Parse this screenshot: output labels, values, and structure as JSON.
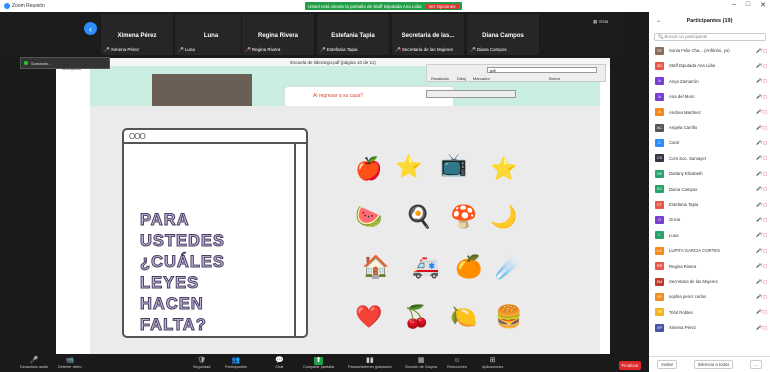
{
  "titlebar": {
    "app": "Zoom Reunión",
    "banner": "Usted está viendo la pantalla de Staff Diputada Ana Lidia",
    "stop_label": "Ver Opciones",
    "minimize": "–",
    "maximize": "□",
    "close": "✕"
  },
  "video_tiles": [
    {
      "name": "Ximena Pérez",
      "label": "Ximena Pérez"
    },
    {
      "name": "Luna",
      "label": "Luna"
    },
    {
      "name": "Regina Rivera",
      "label": "Regina Rivera"
    },
    {
      "name": "Estefania Tapia",
      "label": "Estefania Tapia"
    },
    {
      "name": "Secretaria de las...",
      "label": "Secretaria de las Mujeres"
    },
    {
      "name": "Diana Campos",
      "label": "Diana Campos"
    }
  ],
  "view_label": "Vista",
  "selfview_label": "Sumando...",
  "pdf": {
    "title": "Escuela de liderazgo.pdf (página 10 de 11)",
    "compartir": "Compartir",
    "search_value": "pdf",
    "tool_labels": [
      "Resaltado",
      "Dibuj",
      "Marcador",
      "Borrar"
    ],
    "question": "Al regresar a su casa?"
  },
  "slide": {
    "browser_dots": "OOO",
    "lines": [
      "PARA",
      "USTEDES",
      "¿CUÁLES",
      "LEYES",
      "HACEN",
      "FALTA?"
    ]
  },
  "stickers": [
    "🍎",
    "⭐",
    "📺",
    "⭐",
    "🍉",
    "🍳",
    "🍄",
    "🌙",
    "🏠",
    "🚑",
    "🍊",
    "☄️",
    "❤️",
    "🍒",
    "🍋",
    "🍔"
  ],
  "controls": [
    {
      "icon": "🎤",
      "label": "Desactivar audio"
    },
    {
      "icon": "📹",
      "label": "Detener video"
    },
    {
      "icon": "🛡",
      "label": "Seguridad"
    },
    {
      "icon": "👥",
      "label": "Participantes"
    },
    {
      "icon": "💬",
      "label": "Chat"
    },
    {
      "icon": "⬆",
      "label": "Compartir pantalla"
    },
    {
      "icon": "▮▮",
      "label": "Pausar/detener grabación"
    },
    {
      "icon": "▦",
      "label": "Sección de Grupos"
    },
    {
      "icon": "☺",
      "label": "Reacciones"
    },
    {
      "icon": "⊞",
      "label": "Aplicaciones"
    }
  ],
  "end_button": "Finalizar",
  "panel": {
    "title": "Participantes (19)",
    "search_placeholder": "Buscar un participante",
    "participants": [
      {
        "name": "Sonia Felix Cha... (Anfitrión, yo)",
        "initials": "SF",
        "color": "#8a6d5a"
      },
      {
        "name": "Staff Diputada Ana Lidia",
        "initials": "SD",
        "color": "#e8574c"
      },
      {
        "name": "Anya Zamarrón",
        "initials": "A",
        "color": "#7a3fd1"
      },
      {
        "name": "Ana del Muro",
        "initials": "A",
        "color": "#7a3fd1"
      },
      {
        "name": "Andrea Martínez",
        "initials": "A",
        "color": "#f28c1e"
      },
      {
        "name": "Angela Carrillo",
        "initials": "AC",
        "color": "#555"
      },
      {
        "name": "Carol",
        "initials": "C",
        "color": "#2d8cff"
      },
      {
        "name": "Com.Soc. Samayel",
        "initials": "CS",
        "color": "#334"
      },
      {
        "name": "Darlany Elizabeth",
        "initials": "DE",
        "color": "#27a36a"
      },
      {
        "name": "Diana Campos",
        "initials": "DC",
        "color": "#27a36a"
      },
      {
        "name": "Estefania Tapia",
        "initials": "ET",
        "color": "#e8574c"
      },
      {
        "name": "Gricia",
        "initials": "G",
        "color": "#7a3fd1"
      },
      {
        "name": "Luna",
        "initials": "L",
        "color": "#27a36a"
      },
      {
        "name": "LUPITA GARCIA CORTES",
        "initials": "LG",
        "color": "#f28c1e"
      },
      {
        "name": "Regina Rivera",
        "initials": "RR",
        "color": "#e8574c"
      },
      {
        "name": "Secretaria de las Mujeres",
        "initials": "SM",
        "color": "#c0392b"
      },
      {
        "name": "sophia perez carlos",
        "initials": "SP",
        "color": "#f28c1e"
      },
      {
        "name": "Tofol Robles",
        "initials": "TR",
        "color": "#f2b51e"
      },
      {
        "name": "Ximena Pérez",
        "initials": "XP",
        "color": "#4455aa"
      }
    ],
    "invite": "Invitar",
    "mute_all": "Silenciar a todos",
    "more": "..."
  }
}
